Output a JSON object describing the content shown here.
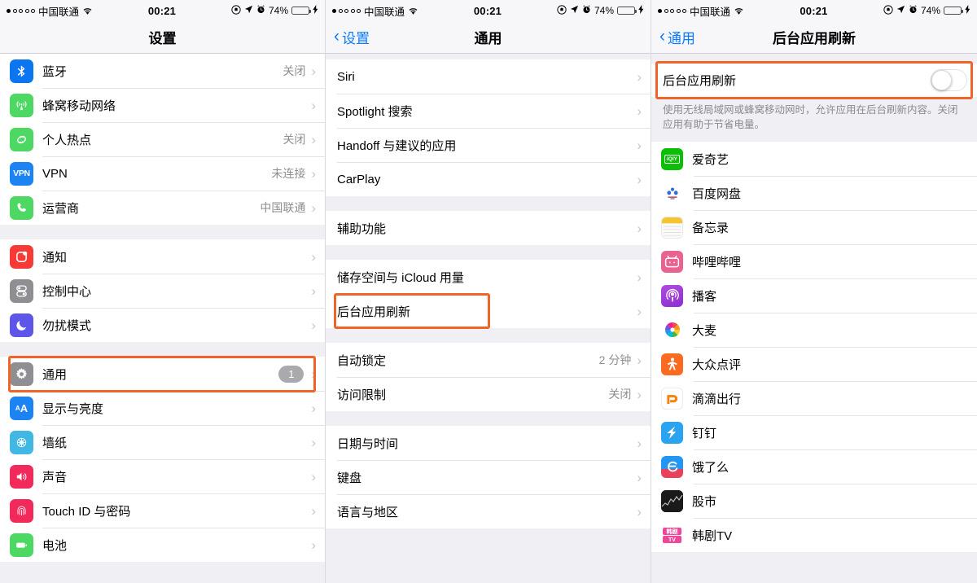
{
  "statusbar": {
    "signal_filled": 1,
    "signal_total": 5,
    "carrier": "中国联通",
    "wifi_icon": "wifi-icon",
    "time": "00:21",
    "rotation_lock_icon": "rotation-lock-icon",
    "location_icon": "location-arrow-icon",
    "alarm_icon": "alarm-clock-icon",
    "battery_percent": "74%",
    "battery_level": 74,
    "battery_color": "#4cd564",
    "charging_icon": "lightning-bolt-icon"
  },
  "highlight_color": "#f0642a",
  "panels": {
    "settings": {
      "nav": {
        "title": "设置",
        "back": null
      },
      "groups": [
        {
          "rows": [
            {
              "icon": "bluetooth-icon",
              "label": "蓝牙",
              "value": "关闭",
              "chevron": true
            },
            {
              "icon": "cellular-icon",
              "label": "蜂窝移动网络",
              "value": "",
              "chevron": true
            },
            {
              "icon": "hotspot-icon",
              "label": "个人热点",
              "value": "关闭",
              "chevron": true
            },
            {
              "icon": "vpn-icon",
              "label": "VPN",
              "value": "未连接",
              "chevron": true
            },
            {
              "icon": "phone-icon",
              "label": "运营商",
              "value": "中国联通",
              "chevron": true
            }
          ]
        },
        {
          "rows": [
            {
              "icon": "notifications-icon",
              "label": "通知",
              "value": "",
              "chevron": true
            },
            {
              "icon": "control-center-icon",
              "label": "控制中心",
              "value": "",
              "chevron": true
            },
            {
              "icon": "do-not-disturb-icon",
              "label": "勿扰模式",
              "value": "",
              "chevron": true
            }
          ]
        },
        {
          "rows": [
            {
              "icon": "gear-icon",
              "label": "通用",
              "badge": "1",
              "chevron": true,
              "highlighted": true
            },
            {
              "icon": "display-brightness-icon",
              "label": "显示与亮度",
              "value": "",
              "chevron": true
            },
            {
              "icon": "wallpaper-icon",
              "label": "墙纸",
              "value": "",
              "chevron": true
            },
            {
              "icon": "sound-icon",
              "label": "声音",
              "value": "",
              "chevron": true
            },
            {
              "icon": "touchid-icon",
              "label": "Touch ID 与密码",
              "value": "",
              "chevron": true
            },
            {
              "icon": "battery-icon",
              "label": "电池",
              "value": "",
              "chevron": true
            }
          ]
        }
      ]
    },
    "general": {
      "nav": {
        "title": "通用",
        "back": "设置"
      },
      "groups": [
        {
          "rows": [
            {
              "label": "Siri",
              "value": "",
              "chevron": true
            },
            {
              "label": "Spotlight 搜索",
              "value": "",
              "chevron": true
            },
            {
              "label": "Handoff 与建议的应用",
              "value": "",
              "chevron": true
            },
            {
              "label": "CarPlay",
              "value": "",
              "chevron": true
            }
          ]
        },
        {
          "rows": [
            {
              "label": "辅助功能",
              "value": "",
              "chevron": true
            }
          ]
        },
        {
          "rows": [
            {
              "label": "储存空间与 iCloud 用量",
              "value": "",
              "chevron": true
            },
            {
              "label": "后台应用刷新",
              "value": "",
              "chevron": true,
              "highlighted": true
            }
          ]
        },
        {
          "rows": [
            {
              "label": "自动锁定",
              "value": "2 分钟",
              "chevron": true
            },
            {
              "label": "访问限制",
              "value": "关闭",
              "chevron": true
            }
          ]
        },
        {
          "rows": [
            {
              "label": "日期与时间",
              "value": "",
              "chevron": true
            },
            {
              "label": "键盘",
              "value": "",
              "chevron": true
            },
            {
              "label": "语言与地区",
              "value": "",
              "chevron": true
            }
          ]
        }
      ]
    },
    "background_refresh": {
      "nav": {
        "title": "后台应用刷新",
        "back": "通用"
      },
      "master_toggle": {
        "label": "后台应用刷新",
        "state": "off",
        "highlighted": true
      },
      "footnote": "使用无线局域网或蜂窝移动网时，允许应用在后台刷新内容。关闭应用有助于节省电量。",
      "apps": [
        {
          "icon": "iqiyi-icon",
          "label": "爱奇艺"
        },
        {
          "icon": "baidu-netdisk-icon",
          "label": "百度网盘"
        },
        {
          "icon": "notes-icon",
          "label": "备忘录"
        },
        {
          "icon": "bilibili-icon",
          "label": "哔哩哔哩"
        },
        {
          "icon": "podcasts-icon",
          "label": "播客"
        },
        {
          "icon": "damai-icon",
          "label": "大麦"
        },
        {
          "icon": "dianping-icon",
          "label": "大众点评"
        },
        {
          "icon": "didi-icon",
          "label": "滴滴出行"
        },
        {
          "icon": "dingtalk-icon",
          "label": "钉钉"
        },
        {
          "icon": "eleme-icon",
          "label": "饿了么"
        },
        {
          "icon": "stocks-icon",
          "label": "股市"
        },
        {
          "icon": "hanjutv-icon",
          "label": "韩剧TV"
        }
      ]
    }
  }
}
